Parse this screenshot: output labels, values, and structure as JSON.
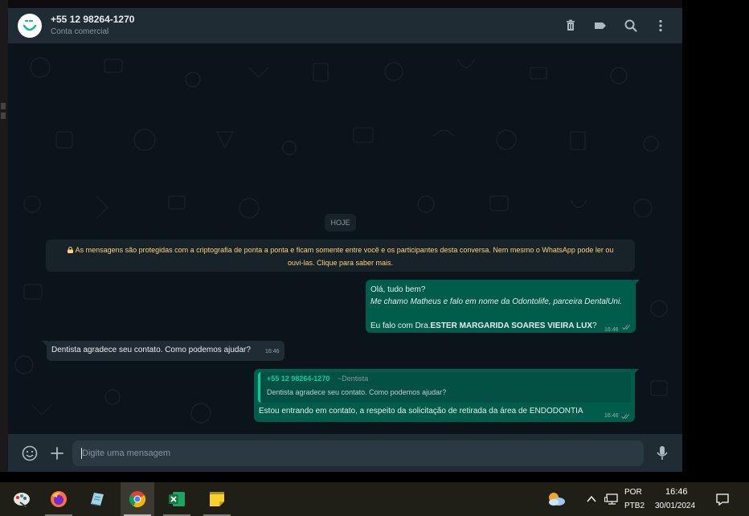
{
  "header": {
    "contact_name": "+55 12 98264-1270",
    "contact_subtitle": "Conta comercial"
  },
  "chat": {
    "date_chip": "HOJE",
    "encryption_notice_line1": "As mensagens são protegidas com a criptografia de ponta a ponta e ficam somente entre você e os participantes desta conversa. Nem mesmo o WhatsApp pode ler ou",
    "encryption_notice_line2": "ouvi-las. Clique para saber mais.",
    "messages": [
      {
        "direction": "out",
        "line1": "Olá, tudo bem?",
        "line2": "Me chamo Matheus e falo em nome da Odontolife, parceira DentalUni.",
        "line3_prefix": "Eu falo com Dra.",
        "line3_bold": "ESTER MARGARIDA SOARES VIEIRA LUX",
        "line3_suffix": "?",
        "time": "16:46"
      },
      {
        "direction": "in",
        "text": "Dentista agradece seu contato. Como podemos ajudar?",
        "time": "16:46"
      },
      {
        "direction": "out",
        "quote_author": "+55 12 98264-1270",
        "quote_sender": "~Dentista",
        "quote_text": "Dentista agradece seu contato. Como podemos ajudar?",
        "text": "Estou entrando em contato, a respeito da solicitação de retirada da área de ENDODONTIA",
        "time": "16:46"
      }
    ]
  },
  "composer": {
    "placeholder": "Digite uma mensagem"
  },
  "taskbar": {
    "apps": [
      "paint-icon",
      "firefox-icon",
      "notepad-icon",
      "chrome-icon",
      "excel-icon",
      "sticky-notes-icon"
    ],
    "lang_line1": "POR",
    "lang_line2": "PTB2",
    "time": "16:46",
    "date": "30/01/2024"
  },
  "colors": {
    "header_bg": "#202c33",
    "chat_bg": "#0b141a",
    "outgoing_bubble": "#005c4b",
    "incoming_bubble": "#202c33",
    "encryption_text": "#ffd279",
    "quote_accent": "#06cf9c",
    "read_ticks": "#8696a0"
  }
}
